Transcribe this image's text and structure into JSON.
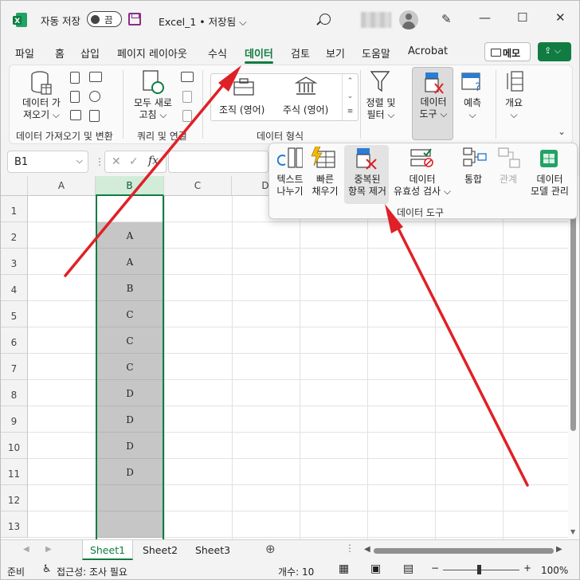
{
  "titlebar": {
    "autosave_label": "자동 저장",
    "autosave_state": "끔",
    "doc_title": "Excel_1 • 저장됨 ⌵"
  },
  "tabs": [
    "파일",
    "홈",
    "삽입",
    "페이지 레이아웃",
    "수식",
    "데이터",
    "검토",
    "보기",
    "도움말",
    "Acrobat"
  ],
  "active_tab": "데이터",
  "memo_label": "메모",
  "ribbon": {
    "get_data_label": "데이터 가\n져오기 ⌵",
    "group_get_transform": "데이터 가져오기 및 변환",
    "refresh_label": "모두 새로\n고침 ⌵",
    "group_queries": "쿼리 및 연결",
    "stocks_label": "조직 (영어)",
    "currency_label": "주식 (영어)",
    "group_data_types": "데이터 형식",
    "sort_filter_label": "정렬 및\n필터 ⌵",
    "data_tools_label": "데이터\n도구 ⌵",
    "forecast_label": "예측\n⌵",
    "outline_label": "개요\n⌵"
  },
  "popup": {
    "text_to_columns": "텍스트\n나누기",
    "flash_fill": "빠른\n채우기",
    "remove_duplicates": "중복된\n항목 제거",
    "data_validation": "데이터\n유효성 검사 ⌵",
    "consolidate": "통합",
    "relationships": "관계",
    "data_model": "데이터\n모델 관리",
    "group_label": "데이터 도구"
  },
  "formula_bar": {
    "name_box": "B1",
    "fx": "fx"
  },
  "grid": {
    "columns": [
      "A",
      "B",
      "C",
      "D"
    ],
    "rows": [
      "1",
      "2",
      "3",
      "4",
      "5",
      "6",
      "7",
      "8",
      "9",
      "10",
      "11",
      "12",
      "13"
    ],
    "b_values": [
      "",
      "A",
      "A",
      "B",
      "C",
      "C",
      "C",
      "D",
      "D",
      "D",
      "D",
      "",
      ""
    ]
  },
  "sheets": [
    "Sheet1",
    "Sheet2",
    "Sheet3"
  ],
  "active_sheet": "Sheet1",
  "status": {
    "ready": "준비",
    "accessibility": "접근성: 조사 필요",
    "count": "개수: 10",
    "zoom": "100%"
  },
  "colors": {
    "accent": "#107c41",
    "arrow": "#e02027"
  }
}
